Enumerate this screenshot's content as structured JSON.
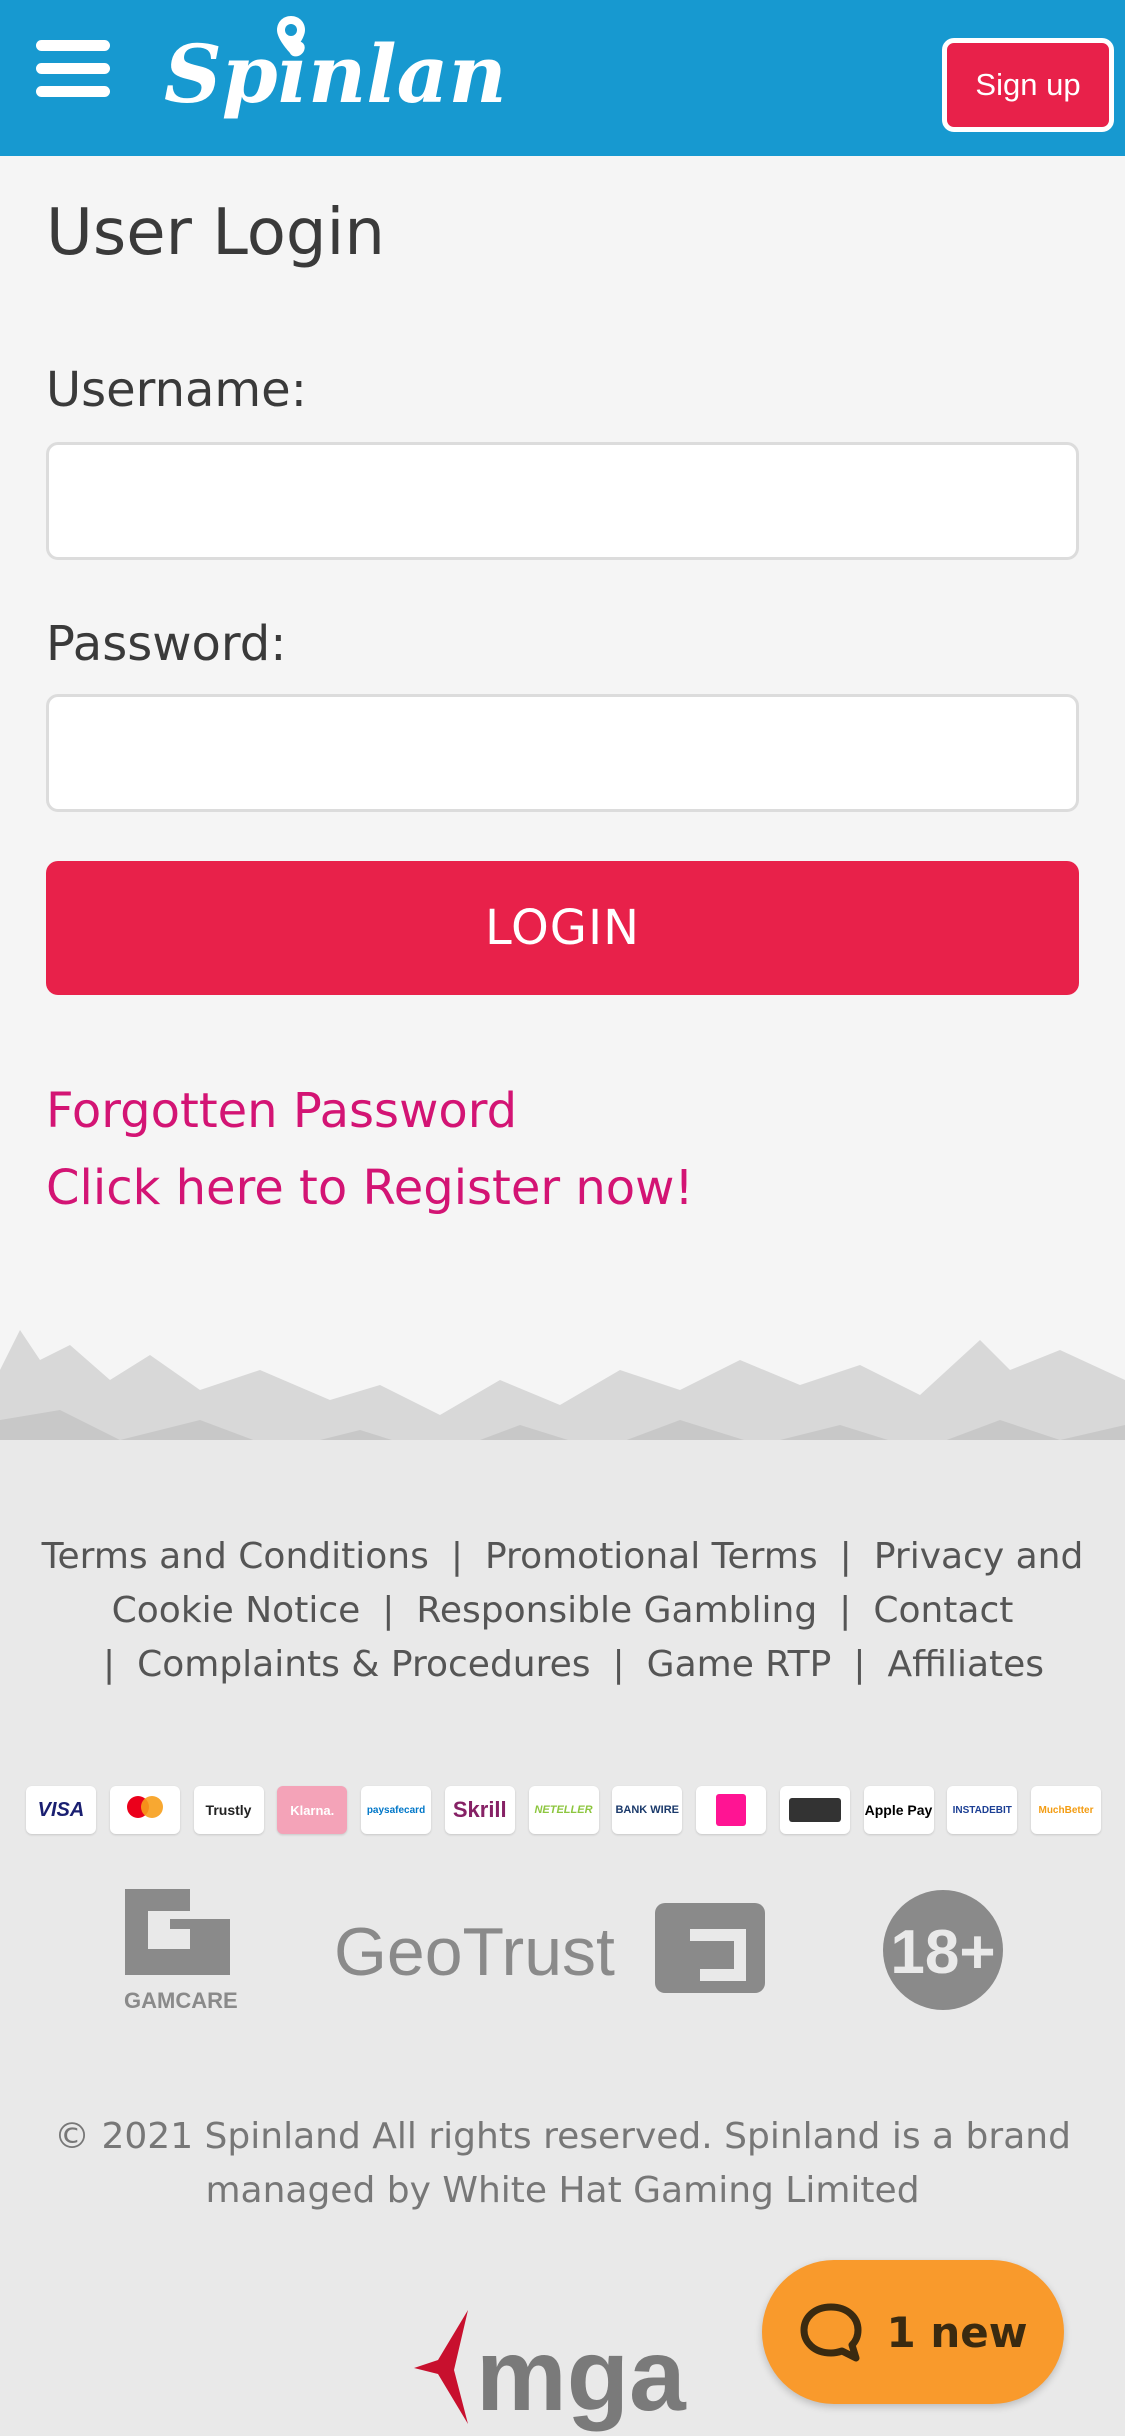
{
  "header": {
    "brand": "Spinland",
    "signup_label": "Sign up",
    "bg_color": "#1799d0"
  },
  "login": {
    "title": "User Login",
    "username_label": "Username:",
    "password_label": "Password:",
    "username_value": "",
    "password_value": "",
    "login_label": "LOGIN",
    "forgot_label": "Forgotten Password",
    "register_label": "Click here to Register now!",
    "accent_color": "#e8214a",
    "link_color": "#d31474"
  },
  "footer": {
    "links": [
      "Terms and Conditions",
      "Promotional Terms",
      "Privacy and Cookie Notice",
      "Responsible Gambling",
      "Contact",
      "Complaints & Procedures",
      "Game RTP",
      "Affiliates"
    ],
    "payments": [
      "VISA",
      "mastercard",
      "Trustly",
      "Klarna.",
      "paysafecard",
      "Skrill",
      "NETELLER",
      "BANK WIRE",
      "Fonix",
      "Boku",
      "Apple Pay",
      "INSTADEBIT",
      "MuchBetter"
    ],
    "badges": [
      "GAMCARE",
      "GeoTrust",
      "18+"
    ],
    "copyright": "© 2021 Spinland All rights reserved. Spinland is a brand managed by White Hat Gaming Limited",
    "mga": "mga"
  },
  "chat": {
    "label": "1 new",
    "color": "#f99a2c"
  }
}
